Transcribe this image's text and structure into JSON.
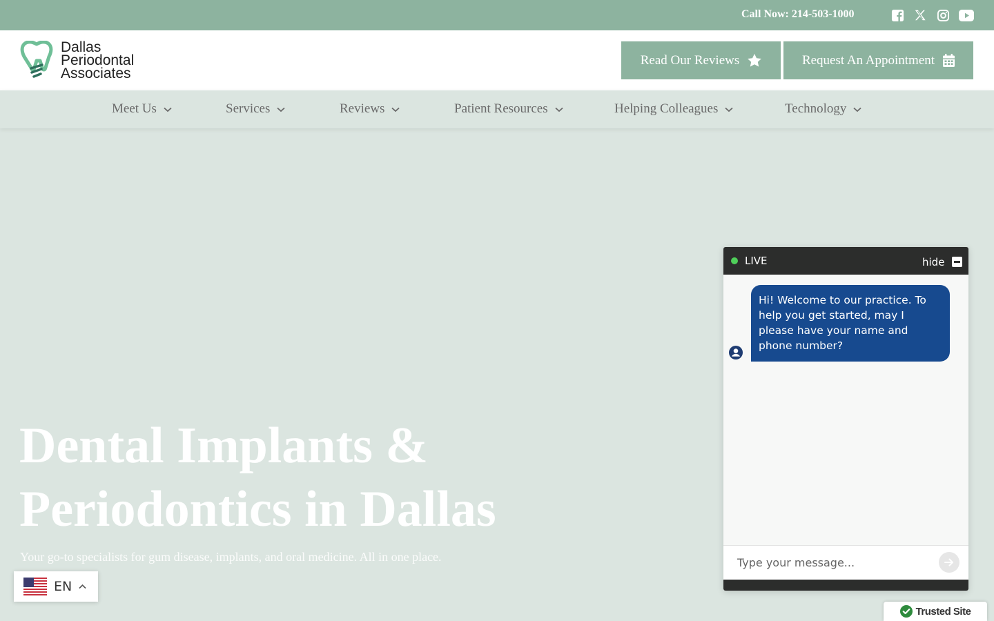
{
  "topbar": {
    "call_label": "Call Now: 214-503-1000",
    "social": [
      "facebook-icon",
      "x-icon",
      "instagram-icon",
      "youtube-icon"
    ]
  },
  "logo": {
    "line1": "Dallas",
    "line2": "Periodontal",
    "line3": "Associates"
  },
  "header": {
    "reviews_label": "Read Our Reviews",
    "appointment_label": "Request An Appointment"
  },
  "nav": {
    "items": [
      {
        "label": "Meet Us"
      },
      {
        "label": "Services"
      },
      {
        "label": "Reviews"
      },
      {
        "label": "Patient Resources"
      },
      {
        "label": "Helping Colleagues"
      },
      {
        "label": "Technology"
      }
    ]
  },
  "hero": {
    "title_line1": "Dental Implants &",
    "title_line2": "Periodontics in Dallas",
    "subtitle": "Your go-to specialists for gum disease, implants, and oral medicine. All in one place."
  },
  "language": {
    "code": "EN"
  },
  "chat": {
    "status": "LIVE",
    "hide_label": "hide",
    "message": "Hi! Welcome to our practice. To help you get started, may I please have your name and phone number?",
    "input_placeholder": "Type your message..."
  },
  "trusted": {
    "label": "Trusted Site"
  },
  "colors": {
    "brand_green": "#8db39f",
    "nav_bg": "#dbe5e0",
    "chat_bubble": "#174a8f",
    "chat_header": "#2c2d2c",
    "live_dot": "#4fd05a"
  }
}
